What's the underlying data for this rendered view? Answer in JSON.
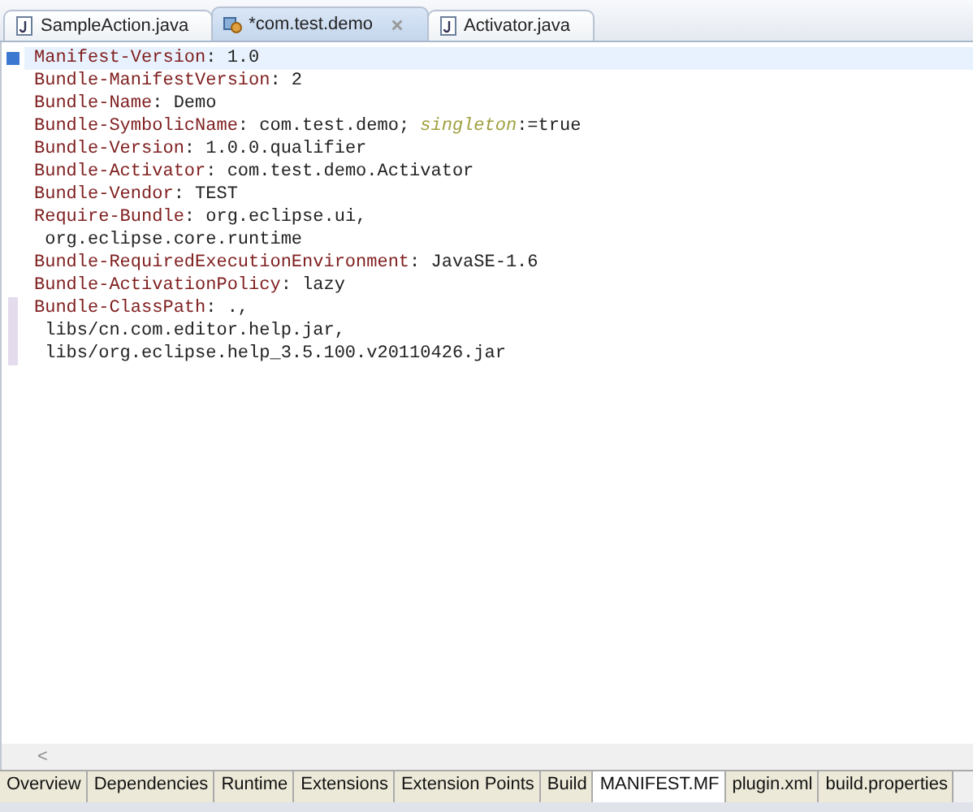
{
  "editor_tabs": [
    {
      "label": "SampleAction.java",
      "kind": "java",
      "selected": false,
      "closable": false
    },
    {
      "label": "*com.test.demo",
      "kind": "plugin",
      "selected": true,
      "closable": true
    },
    {
      "label": "Activator.java",
      "kind": "java",
      "selected": false,
      "closable": false
    }
  ],
  "lines": [
    {
      "selected": true,
      "changed": false,
      "segments": [
        {
          "kind": "key",
          "text": "Manifest-Version"
        },
        {
          "kind": "text",
          "text": ": 1.0"
        }
      ]
    },
    {
      "selected": false,
      "changed": false,
      "segments": [
        {
          "kind": "key",
          "text": "Bundle-ManifestVersion"
        },
        {
          "kind": "text",
          "text": ": 2"
        }
      ]
    },
    {
      "selected": false,
      "changed": false,
      "segments": [
        {
          "kind": "key",
          "text": "Bundle-Name"
        },
        {
          "kind": "text",
          "text": ": Demo"
        }
      ]
    },
    {
      "selected": false,
      "changed": false,
      "segments": [
        {
          "kind": "key",
          "text": "Bundle-SymbolicName"
        },
        {
          "kind": "text",
          "text": ": com.test.demo; "
        },
        {
          "kind": "attr",
          "text": "singleton"
        },
        {
          "kind": "text",
          "text": ":=true"
        }
      ]
    },
    {
      "selected": false,
      "changed": false,
      "segments": [
        {
          "kind": "key",
          "text": "Bundle-Version"
        },
        {
          "kind": "text",
          "text": ": 1.0.0.qualifier"
        }
      ]
    },
    {
      "selected": false,
      "changed": false,
      "segments": [
        {
          "kind": "key",
          "text": "Bundle-Activator"
        },
        {
          "kind": "text",
          "text": ": com.test.demo.Activator"
        }
      ]
    },
    {
      "selected": false,
      "changed": false,
      "segments": [
        {
          "kind": "key",
          "text": "Bundle-Vendor"
        },
        {
          "kind": "text",
          "text": ": TEST"
        }
      ]
    },
    {
      "selected": false,
      "changed": false,
      "segments": [
        {
          "kind": "key",
          "text": "Require-Bundle"
        },
        {
          "kind": "text",
          "text": ": org.eclipse.ui,"
        }
      ]
    },
    {
      "selected": false,
      "changed": false,
      "segments": [
        {
          "kind": "text",
          "text": " org.eclipse.core.runtime"
        }
      ]
    },
    {
      "selected": false,
      "changed": false,
      "segments": [
        {
          "kind": "key",
          "text": "Bundle-RequiredExecutionEnvironment"
        },
        {
          "kind": "text",
          "text": ": JavaSE-1.6"
        }
      ]
    },
    {
      "selected": false,
      "changed": false,
      "segments": [
        {
          "kind": "key",
          "text": "Bundle-ActivationPolicy"
        },
        {
          "kind": "text",
          "text": ": lazy"
        }
      ]
    },
    {
      "selected": false,
      "changed": true,
      "segments": [
        {
          "kind": "key",
          "text": "Bundle-ClassPath"
        },
        {
          "kind": "text",
          "text": ": .,"
        }
      ]
    },
    {
      "selected": false,
      "changed": true,
      "segments": [
        {
          "kind": "text",
          "text": " libs/cn.com.editor.help.jar,"
        }
      ]
    },
    {
      "selected": false,
      "changed": true,
      "segments": [
        {
          "kind": "text",
          "text": " libs/org.eclipse.help_3.5.100.v20110426.jar"
        }
      ]
    }
  ],
  "scroll_left": "<",
  "page_tabs": [
    {
      "label": "Overview",
      "selected": false
    },
    {
      "label": "Dependencies",
      "selected": false
    },
    {
      "label": "Runtime",
      "selected": false
    },
    {
      "label": "Extensions",
      "selected": false
    },
    {
      "label": "Extension Points",
      "selected": false
    },
    {
      "label": "Build",
      "selected": false
    },
    {
      "label": "MANIFEST.MF",
      "selected": true
    },
    {
      "label": "plugin.xml",
      "selected": false
    },
    {
      "label": "build.properties",
      "selected": false
    }
  ]
}
